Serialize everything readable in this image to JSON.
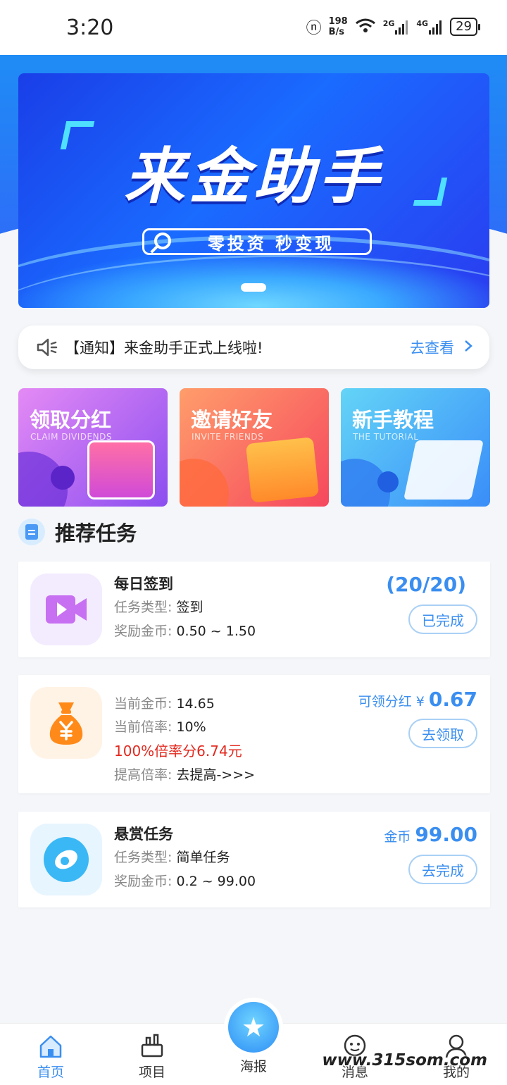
{
  "status_bar": {
    "time": "3:20",
    "net_speed_value": "198",
    "net_speed_unit": "B/s",
    "signal_1": "2G",
    "signal_2": "4G",
    "battery": "29"
  },
  "banner": {
    "title": "来金助手",
    "subtitle": "零投资 秒变现"
  },
  "notice": {
    "text": "【通知】来金助手正式上线啦!",
    "more": "去查看"
  },
  "feature_cards": [
    {
      "title": "领取分红",
      "subtitle": "CLAIM DIVIDENDS"
    },
    {
      "title": "邀请好友",
      "subtitle": "INVITE FRIENDS"
    },
    {
      "title": "新手教程",
      "subtitle": "THE TUTORIAL"
    }
  ],
  "section": {
    "title": "推荐任务"
  },
  "tasks": [
    {
      "name": "每日签到",
      "type_label": "任务类型:",
      "type_value": "签到",
      "reward_label": "奖励金币:",
      "reward_value": "0.50 ~ 1.50",
      "progress": "(20/20)",
      "button": "已完成"
    },
    {
      "coin_label": "当前金币:",
      "coin_value": "14.65",
      "rate_label": "当前倍率:",
      "rate_value": "10%",
      "highlight": "100%倍率分6.74元",
      "boost_label": "提高倍率:",
      "boost_value": "去提高->>>",
      "amount_label": "可领分红 ¥",
      "amount_value": "0.67",
      "button": "去领取"
    },
    {
      "name": "悬赏任务",
      "type_label": "任务类型:",
      "type_value": "简单任务",
      "reward_label": "奖励金币:",
      "reward_value": "0.2 ~ 99.00",
      "amount_label": "金币",
      "amount_value": "99.00",
      "button": "去完成"
    }
  ],
  "tabbar": {
    "home": "首页",
    "projects": "项目",
    "poster": "海报",
    "messages": "消息",
    "mine": "我的"
  },
  "watermark": "www.315som.com",
  "colors": {
    "accent": "#3a8ef0",
    "highlight_red": "#e3281e",
    "banner_blue": "#1a5cff"
  }
}
